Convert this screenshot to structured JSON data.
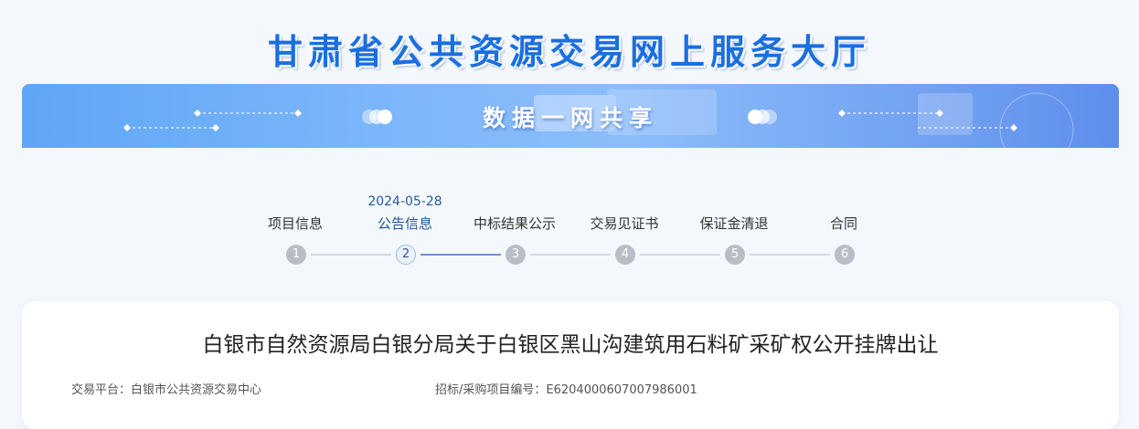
{
  "header": {
    "site_title": "甘肃省公共资源交易网上服务大厅"
  },
  "banner": {
    "slogan": "数据一网共享"
  },
  "steps": [
    {
      "num": "1",
      "label": "项目信息",
      "date": "",
      "active": false
    },
    {
      "num": "2",
      "label": "公告信息",
      "date": "2024-05-28",
      "active": true
    },
    {
      "num": "3",
      "label": "中标结果公示",
      "date": "",
      "active": false
    },
    {
      "num": "4",
      "label": "交易见证书",
      "date": "",
      "active": false
    },
    {
      "num": "5",
      "label": "保证金清退",
      "date": "",
      "active": false
    },
    {
      "num": "6",
      "label": "合同",
      "date": "",
      "active": false
    }
  ],
  "article": {
    "title": "白银市自然资源局白银分局关于白银区黑山沟建筑用石料矿采矿权公开挂牌出让",
    "platform_label": "交易平台：",
    "platform_value": "白银市公共资源交易中心",
    "project_code_label": "招标/采购项目编号：",
    "project_code_value": "E6204000607007986001"
  },
  "colors": {
    "title_blue": "#1a6fe0",
    "active_step": "#1f5596",
    "inactive_step": "#b9bec6"
  }
}
